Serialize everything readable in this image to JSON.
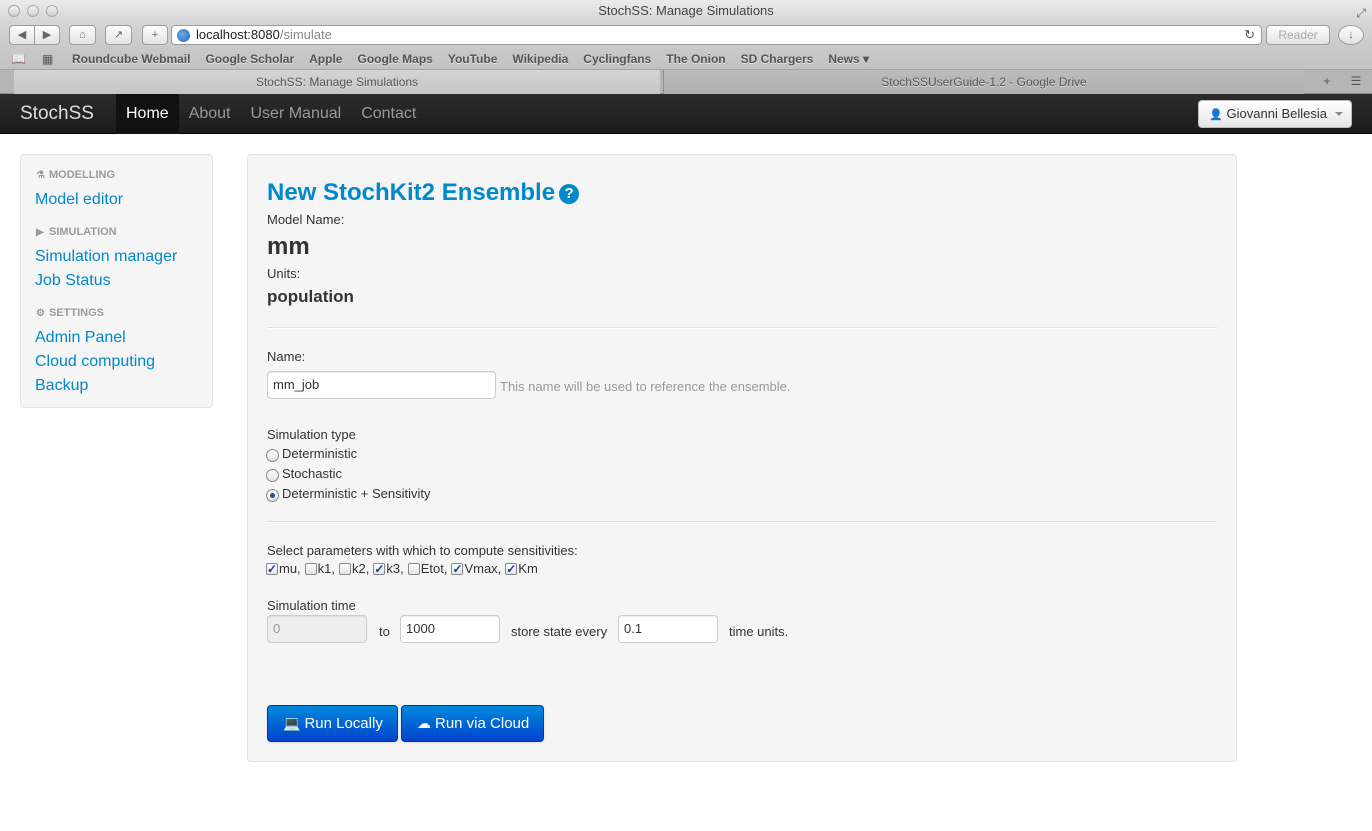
{
  "browser": {
    "window_title": "StochSS: Manage Simulations",
    "url_host": "localhost:8080",
    "url_path": "/simulate",
    "reader_label": "Reader",
    "bookmarks": [
      "Roundcube Webmail",
      "Google Scholar",
      "Apple",
      "Google Maps",
      "YouTube",
      "Wikipedia",
      "Cyclingfans",
      "The Onion",
      "SD Chargers",
      "News ▾"
    ],
    "tabs": [
      {
        "label": "StochSS: Manage Simulations",
        "active": true
      },
      {
        "label": "StochSSUserGuide-1.2 - Google Drive",
        "active": false
      }
    ]
  },
  "navbar": {
    "brand": "StochSS",
    "links": [
      {
        "label": "Home",
        "active": true
      },
      {
        "label": "About",
        "active": false
      },
      {
        "label": "User Manual",
        "active": false
      },
      {
        "label": "Contact",
        "active": false
      }
    ],
    "user": "Giovanni Bellesia"
  },
  "sidebar": {
    "sections": [
      {
        "header": "Modelling",
        "icon": "flask-icon",
        "items": [
          "Model editor"
        ]
      },
      {
        "header": "Simulation",
        "icon": "play-icon",
        "items": [
          "Simulation manager",
          "Job Status"
        ]
      },
      {
        "header": "Settings",
        "icon": "gear-icon",
        "items": [
          "Admin Panel",
          "Cloud computing",
          "Backup"
        ]
      }
    ]
  },
  "main": {
    "title": "New StochKit2 Ensemble",
    "model_name_label": "Model Name:",
    "model_name": "mm",
    "units_label": "Units:",
    "units": "population",
    "name_label": "Name:",
    "name_value": "mm_job",
    "name_help": "This name will be used to reference the ensemble.",
    "sim_type_label": "Simulation type",
    "sim_types": [
      {
        "label": "Deterministic",
        "checked": false
      },
      {
        "label": "Stochastic",
        "checked": false
      },
      {
        "label": "Deterministic + Sensitivity",
        "checked": true
      }
    ],
    "params_label": "Select parameters with which to compute sensitivities:",
    "params": [
      {
        "label": "mu,",
        "checked": true
      },
      {
        "label": "k1,",
        "checked": false
      },
      {
        "label": "k2,",
        "checked": false
      },
      {
        "label": "k3,",
        "checked": true
      },
      {
        "label": "Etot,",
        "checked": false
      },
      {
        "label": "Vmax,",
        "checked": true
      },
      {
        "label": "Km",
        "checked": true
      }
    ],
    "sim_time_label": "Simulation time",
    "time_start": "0",
    "to_label": "to",
    "time_end": "1000",
    "store_label": "store state every",
    "store_value": "0.1",
    "time_units_label": "time units.",
    "run_local_label": "Run Locally",
    "run_cloud_label": "Run via Cloud"
  }
}
